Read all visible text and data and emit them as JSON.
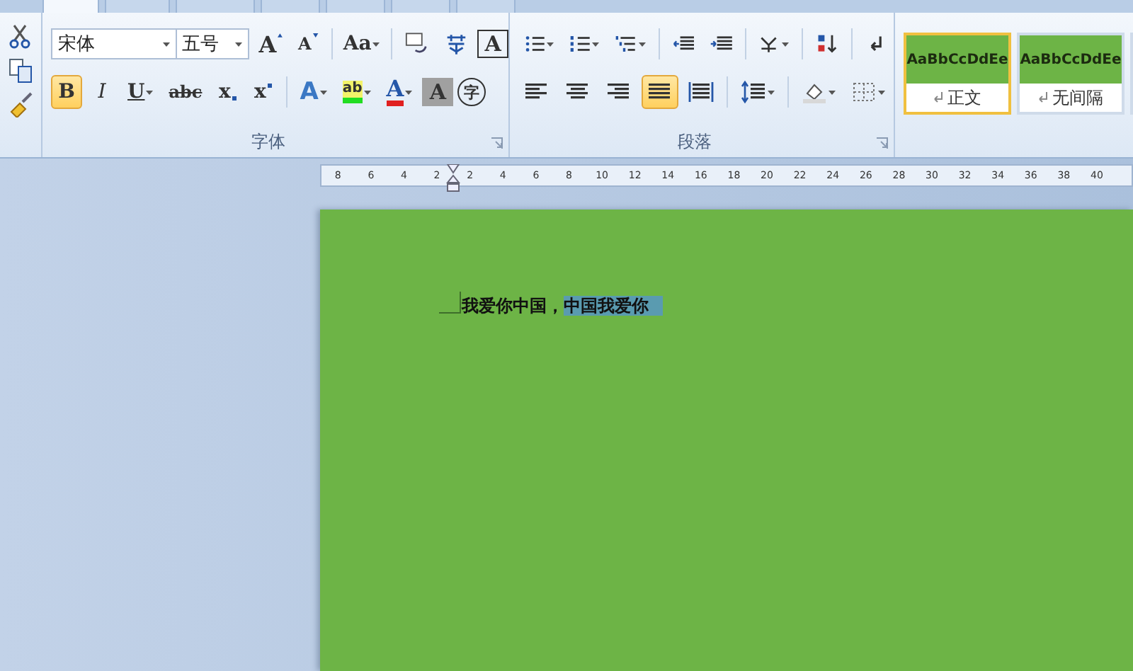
{
  "ribbon_tabs": [
    {
      "selected": true
    },
    {
      "selected": false
    },
    {
      "selected": false
    },
    {
      "selected": false
    },
    {
      "selected": false
    },
    {
      "selected": false
    },
    {
      "selected": false
    }
  ],
  "font_group": {
    "label": "字体",
    "font_name": "宋体",
    "font_size": "五号",
    "row1": [
      {
        "kind": "grow",
        "text": "A"
      },
      {
        "kind": "shrink",
        "text": "A"
      },
      {
        "kind": "case",
        "text": "Aa"
      },
      {
        "kind": "phonetic"
      },
      {
        "kind": "wen"
      },
      {
        "kind": "border",
        "text": "A"
      }
    ],
    "row2": [
      {
        "kind": "bold",
        "text": "B",
        "selected": true
      },
      {
        "kind": "italic",
        "text": "I",
        "selected": false
      },
      {
        "kind": "underline",
        "text": "U",
        "selected": false
      },
      {
        "kind": "strike",
        "text": "abc",
        "selected": false
      },
      {
        "kind": "sub",
        "text": "x",
        "selected": false
      },
      {
        "kind": "sup",
        "text": "x",
        "selected": false
      },
      {
        "kind": "effect",
        "text": "A"
      },
      {
        "kind": "highlight",
        "text": "ab"
      },
      {
        "kind": "color",
        "text": "A"
      },
      {
        "kind": "shade",
        "text": "A"
      },
      {
        "kind": "enclose",
        "text": "字"
      }
    ]
  },
  "paragraph_group": {
    "label": "段落",
    "row1": [
      {
        "kind": "bullets"
      },
      {
        "kind": "numbering"
      },
      {
        "kind": "multilevel"
      },
      {
        "kind": "outdent"
      },
      {
        "kind": "indent"
      },
      {
        "kind": "asian"
      },
      {
        "kind": "sort"
      },
      {
        "kind": "marks"
      }
    ],
    "row2": [
      {
        "kind": "left",
        "selected": false
      },
      {
        "kind": "center",
        "selected": false
      },
      {
        "kind": "right",
        "selected": false
      },
      {
        "kind": "justify",
        "selected": true
      },
      {
        "kind": "distribute",
        "selected": false
      },
      {
        "kind": "spacing"
      },
      {
        "kind": "shading"
      },
      {
        "kind": "borders"
      }
    ]
  },
  "styles": [
    {
      "sample": "AaBbCcDdEe",
      "name": "正文",
      "selected": true
    },
    {
      "sample": "AaBbCcDdEe",
      "name": "无间隔",
      "selected": false
    }
  ],
  "ruler": [
    "8",
    "6",
    "4",
    "2",
    "2",
    "4",
    "6",
    "8",
    "10",
    "12",
    "14",
    "16",
    "18",
    "20",
    "22",
    "24",
    "26",
    "28",
    "30",
    "32",
    "34",
    "36",
    "38",
    "40"
  ],
  "document": {
    "segments": [
      {
        "text": "我爱你中国，",
        "selected": false
      },
      {
        "text": "中国我爱你",
        "selected": true
      }
    ]
  }
}
